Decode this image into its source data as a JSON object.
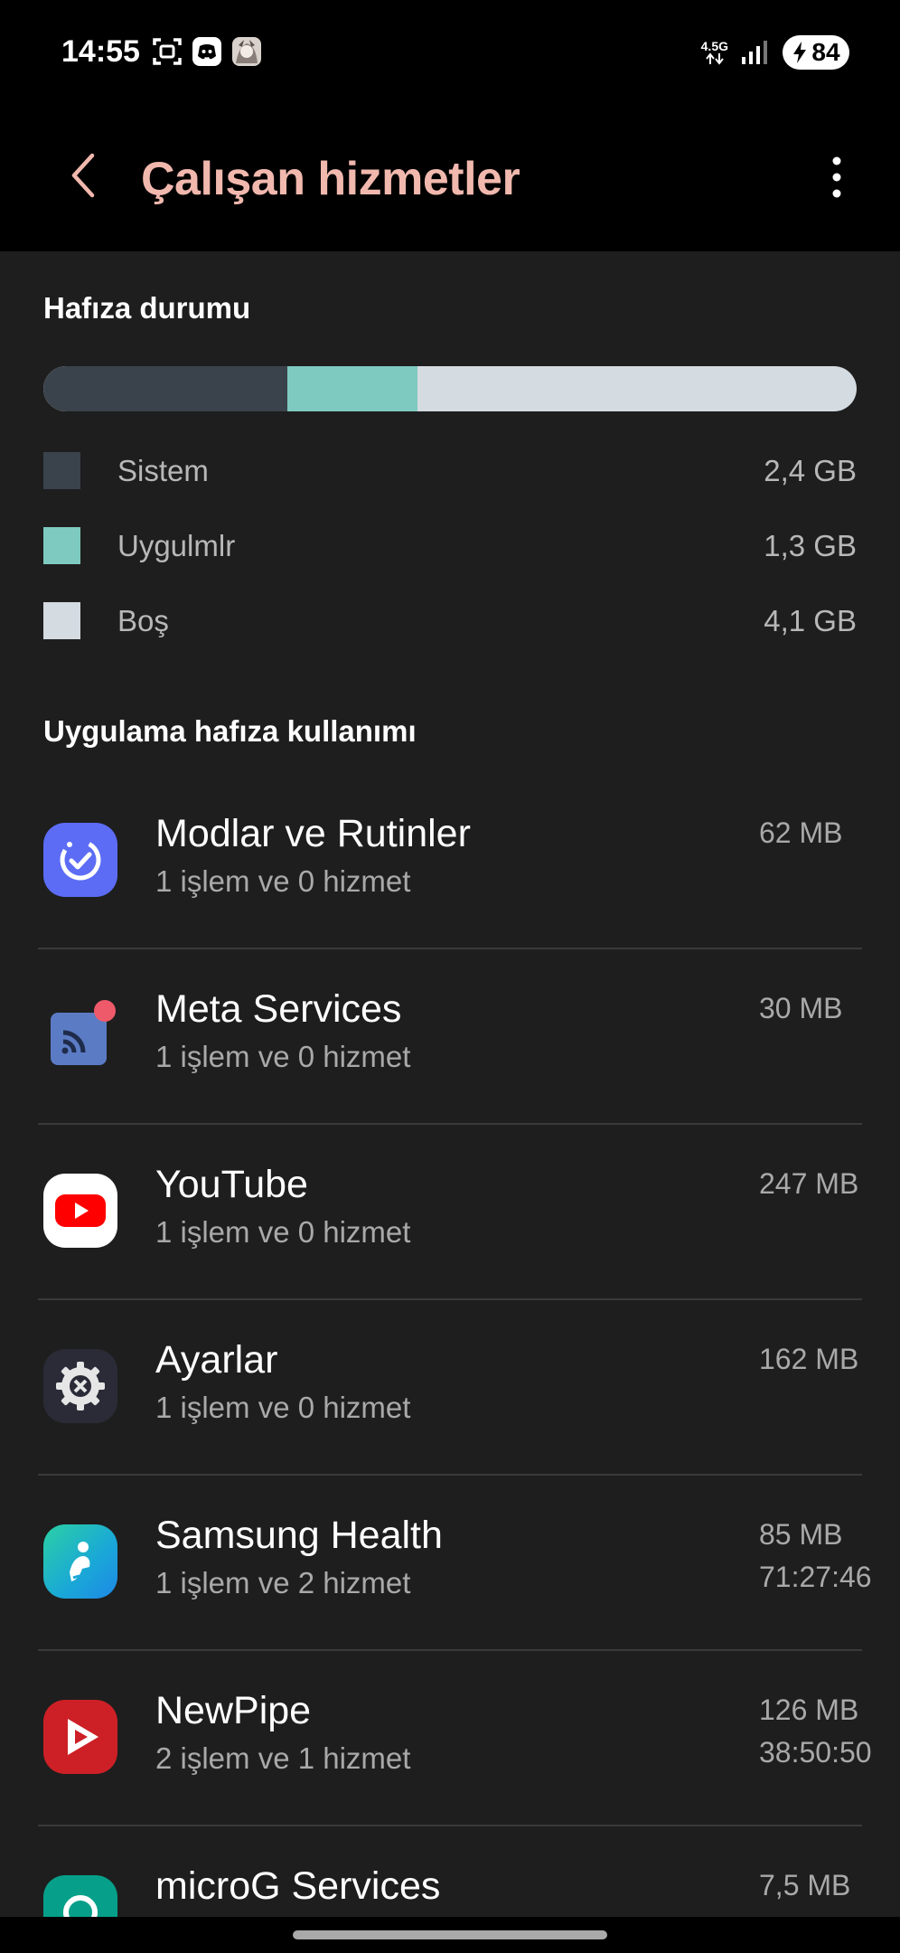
{
  "status_bar": {
    "time": "14:55",
    "network_type": "4.5G",
    "battery_level": "84",
    "notification_icons": [
      "screenshot-icon",
      "discord-icon",
      "avatar-icon"
    ]
  },
  "app_bar": {
    "title": "Çalışan hizmetler",
    "title_color": "#f1b8ae"
  },
  "memory_status": {
    "title": "Hafıza durumu",
    "segments": [
      {
        "label": "Sistem",
        "value": "2,4 GB",
        "color": "#3a434c",
        "fraction": 0.3
      },
      {
        "label": "Uygulmlr",
        "value": "1,3 GB",
        "color": "#7ecac0",
        "fraction": 0.16
      },
      {
        "label": "Boş",
        "value": "4,1 GB",
        "color": "#d4dbe1",
        "fraction": 0.54
      }
    ]
  },
  "app_usage": {
    "title": "Uygulama hafıza kullanımı",
    "apps": [
      {
        "name": "Modlar ve Rutinler",
        "detail": "1 işlem ve 0 hizmet",
        "memory": "62 MB",
        "duration": "",
        "icon": "modes-routines-icon"
      },
      {
        "name": "Meta Services",
        "detail": "1 işlem ve 0 hizmet",
        "memory": "30 MB",
        "duration": "",
        "icon": "meta-services-icon"
      },
      {
        "name": "YouTube",
        "detail": "1 işlem ve 0 hizmet",
        "memory": "247 MB",
        "duration": "",
        "icon": "youtube-icon"
      },
      {
        "name": "Ayarlar",
        "detail": "1 işlem ve 0 hizmet",
        "memory": "162 MB",
        "duration": "",
        "icon": "settings-icon"
      },
      {
        "name": "Samsung Health",
        "detail": "1 işlem ve 2 hizmet",
        "memory": "85 MB",
        "duration": "71:27:46",
        "icon": "samsung-health-icon"
      },
      {
        "name": "NewPipe",
        "detail": "2 işlem ve 1 hizmet",
        "memory": "126 MB",
        "duration": "38:50:50",
        "icon": "newpipe-icon"
      },
      {
        "name": "microG Services",
        "detail": "",
        "memory": "7,5 MB",
        "duration": "",
        "icon": "microg-icon"
      }
    ]
  }
}
